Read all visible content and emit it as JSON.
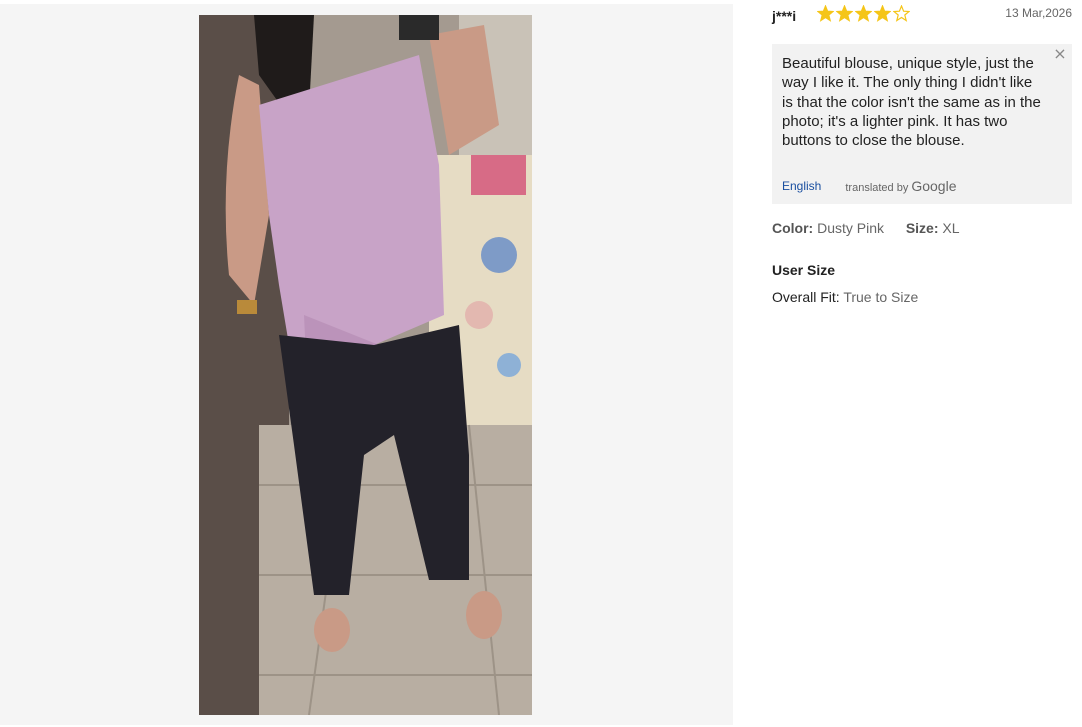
{
  "review": {
    "reviewer": "j***i",
    "rating": 4,
    "rating_max": 5,
    "date": "13 Mar,2026",
    "text": "Beautiful blouse, unique style, just the way I like it. The only thing I didn't like is that the color isn't the same as in the photo; it's a lighter pink. It has two buttons to close the blouse.",
    "language_link": "English",
    "translated_by_prefix": "translated by",
    "translated_by_brand": "Google",
    "close_glyph": "×"
  },
  "attributes": {
    "color_label": "Color:",
    "color_value": "Dusty Pink",
    "size_label": "Size:",
    "size_value": "XL"
  },
  "user_size": {
    "title": "User Size",
    "fit_label": "Overall Fit:",
    "fit_value": "True to Size"
  },
  "colors": {
    "star": "#f5c518",
    "link": "#1a4fa0",
    "translation_bg": "#f2f2f2"
  }
}
